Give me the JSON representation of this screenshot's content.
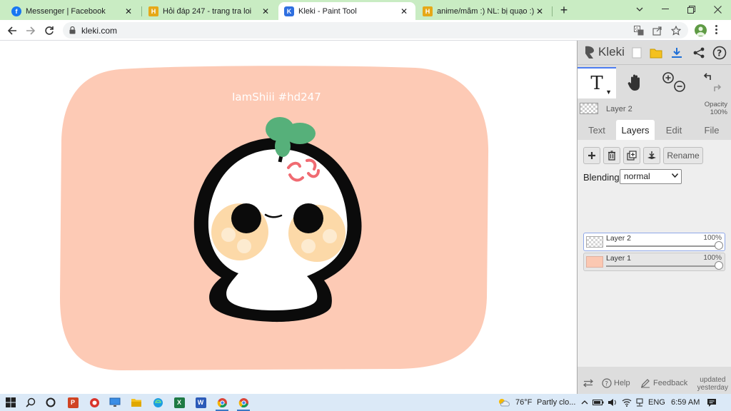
{
  "browser": {
    "tabs": [
      {
        "label": "Messenger | Facebook",
        "icon": "facebook-icon",
        "active": false
      },
      {
        "label": "Hỏi đáp 247 - trang tra loi",
        "icon": "hoidap-icon",
        "active": false
      },
      {
        "label": "Kleki - Paint Tool",
        "icon": "kleki-icon",
        "active": true
      },
      {
        "label": "anime/mằm :) NL: bị quạo :) nén",
        "icon": "hoidap-icon",
        "active": false
      }
    ],
    "new_tab_label": "+",
    "url": "kleki.com"
  },
  "canvas": {
    "drawing_text": "IamShiii #hd247",
    "background_color": "#ffffff",
    "blob_color": "#fdcab5"
  },
  "kleki": {
    "logo_text": "Kleki",
    "current_layer": {
      "name": "Layer 2",
      "opacity_label": "Opacity",
      "opacity_value": "100%"
    },
    "panel_tabs": [
      {
        "label": "Text",
        "active": false
      },
      {
        "label": "Layers",
        "active": true
      },
      {
        "label": "Edit",
        "active": false
      },
      {
        "label": "File",
        "active": false
      }
    ],
    "rename_label": "Rename",
    "blending_label": "Blending",
    "blending_value": "normal",
    "layers": [
      {
        "name": "Layer 2",
        "opacity": "100%",
        "selected": true
      },
      {
        "name": "Layer 1",
        "opacity": "100%",
        "selected": false
      }
    ],
    "footer": {
      "help_label": "Help",
      "feedback_label": "Feedback",
      "updated_line1": "updated",
      "updated_line2": "yesterday"
    },
    "accent_color": "#4d7cf0"
  },
  "taskbar": {
    "weather_temp": "76°F",
    "weather_text": "Partly clo...",
    "language": "ENG",
    "time": "6:59 AM"
  }
}
